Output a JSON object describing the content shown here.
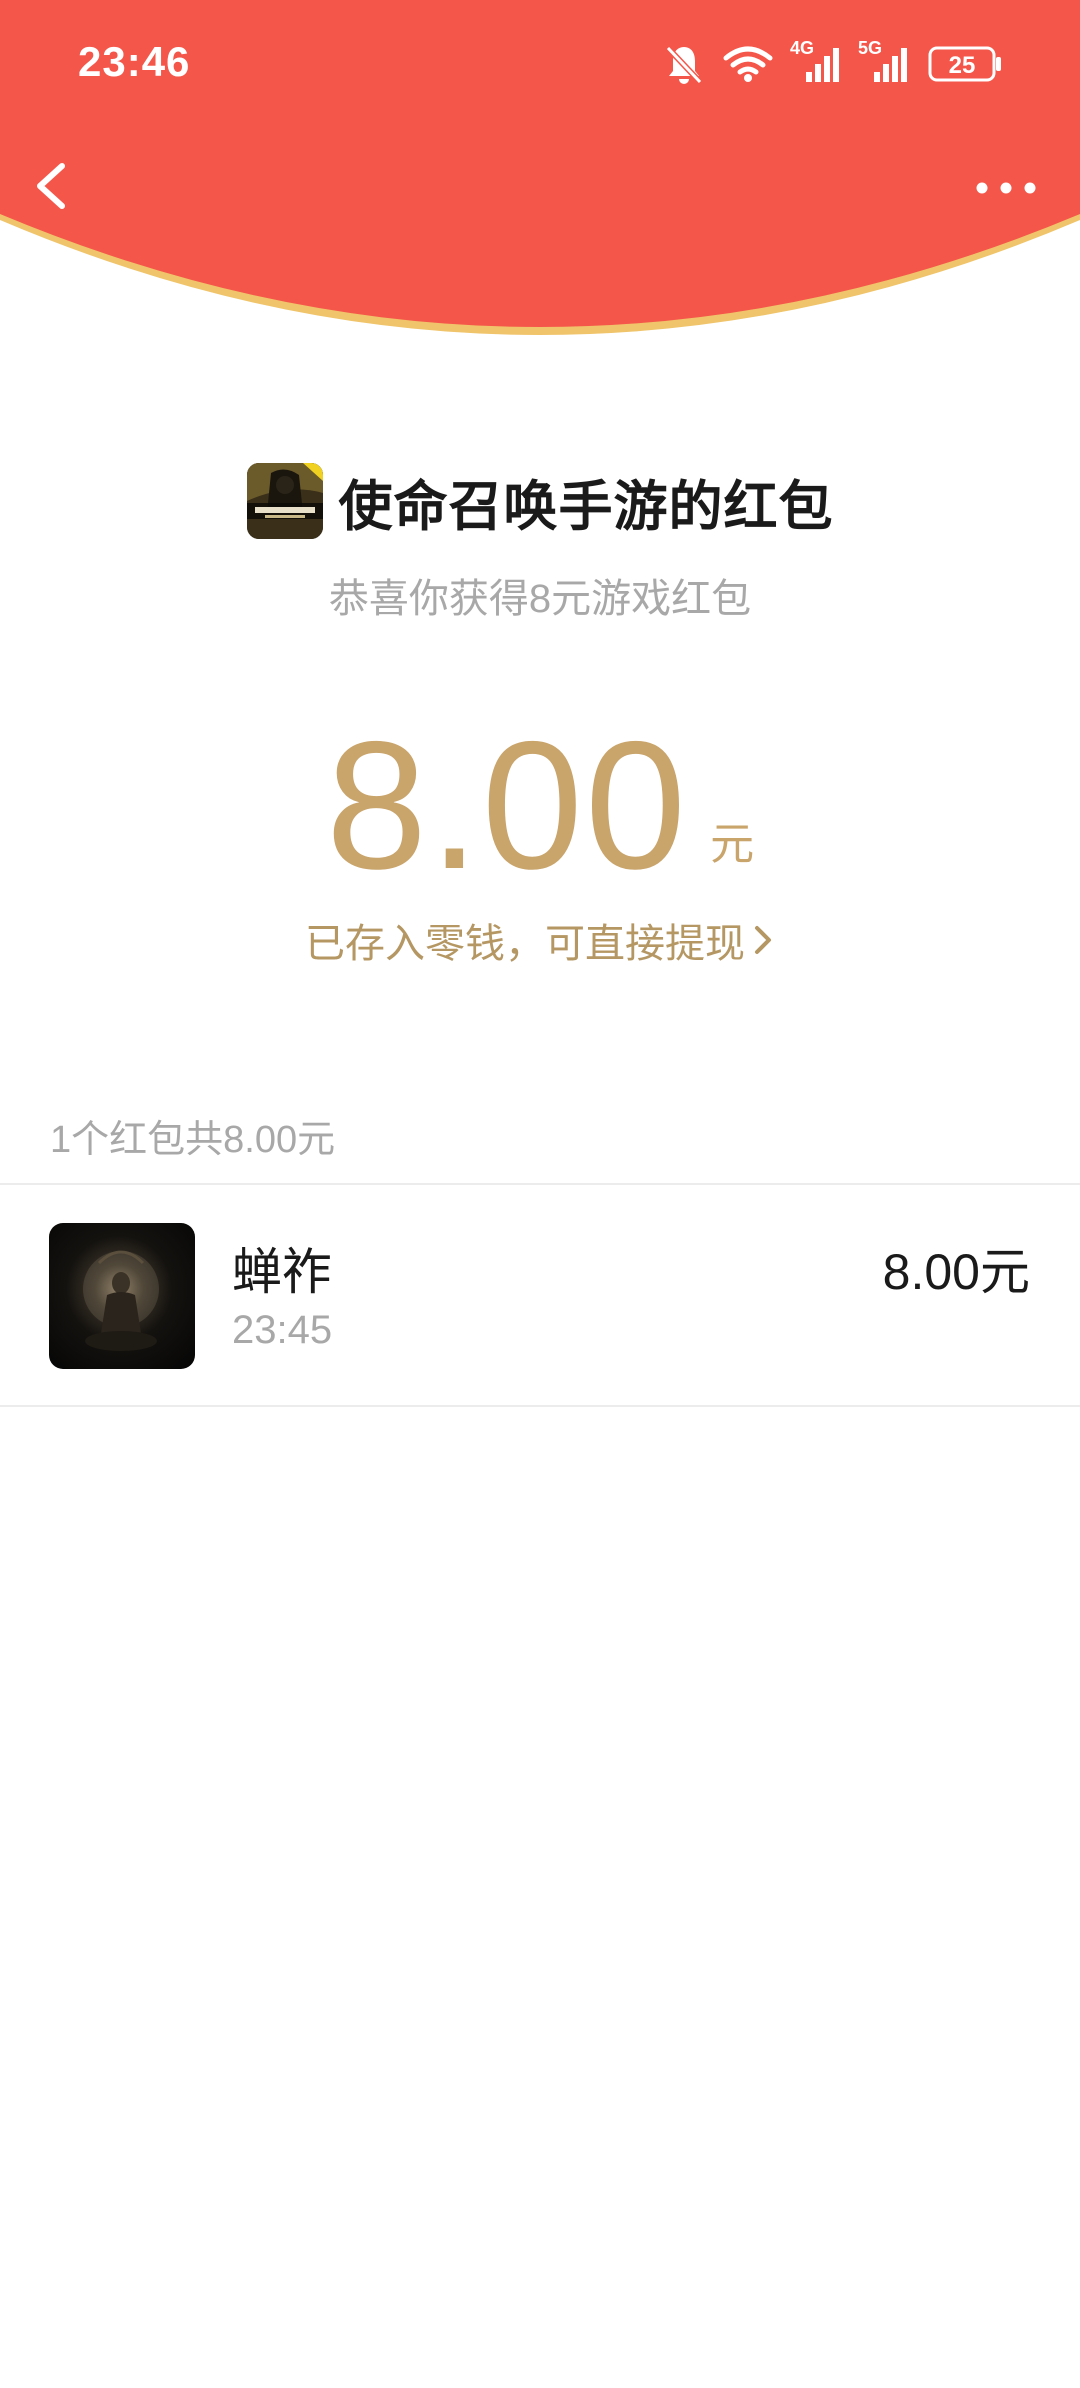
{
  "status_bar": {
    "time": "23:46",
    "battery": "25",
    "network_1": "4G",
    "network_2": "5G",
    "icons": [
      "mute-bell-icon",
      "wifi-icon",
      "signal-4g-icon",
      "signal-5g-icon",
      "battery-icon"
    ]
  },
  "nav": {
    "back_icon": "chevron-left-icon",
    "more_icon": "more-dots-icon"
  },
  "packet": {
    "title": "使命召唤手游的红包",
    "subtitle": "恭喜你获得8元游戏红包",
    "amount": "8.00",
    "unit": "元",
    "wallet_link": "已存入零钱，可直接提现"
  },
  "summary": "1个红包共8.00元",
  "receivers": [
    {
      "name": "蝉祚",
      "time": "23:45",
      "amount": "8.00元"
    }
  ],
  "colors": {
    "header_red": "#f5564a",
    "header_edge": "#f0c46a",
    "gold": "#c9a46b",
    "gray_text": "#a8a8a8"
  }
}
